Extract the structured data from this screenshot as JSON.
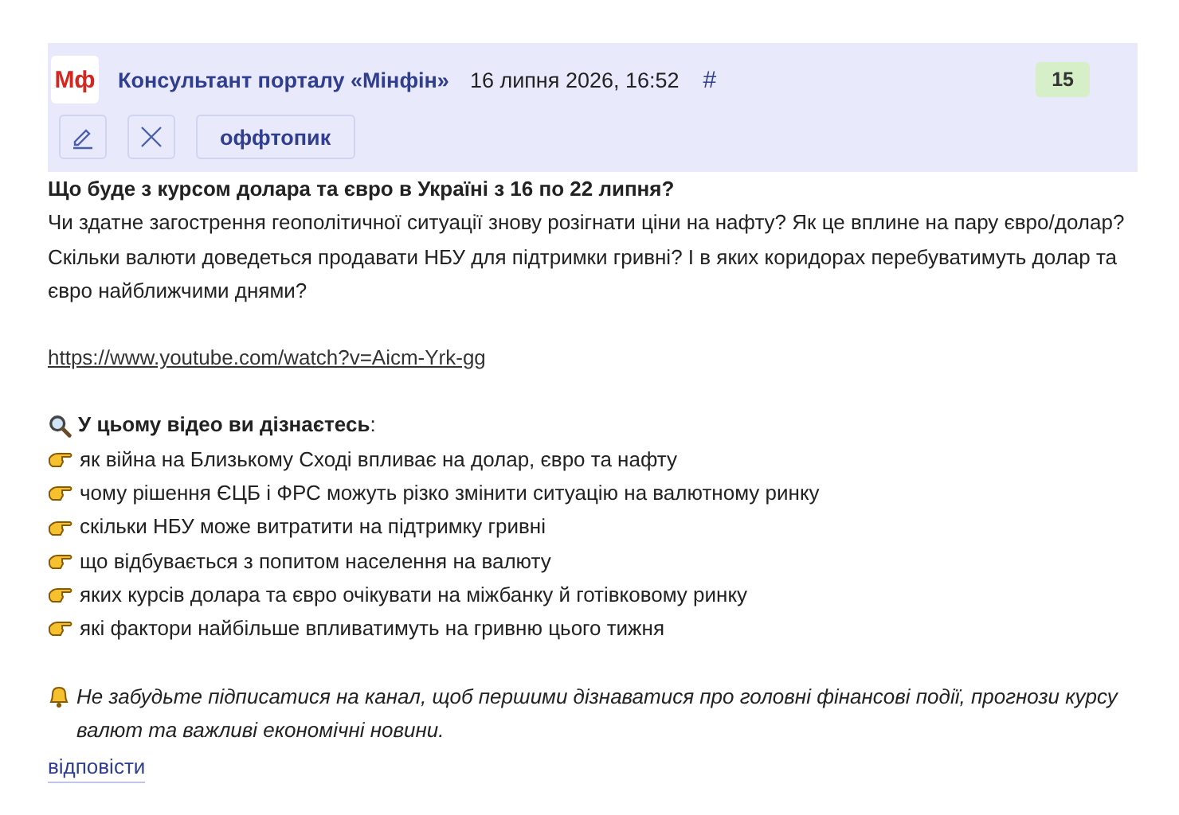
{
  "comment": {
    "logo": "Мф",
    "author": "Консультант порталу «Мінфін»",
    "date": "16 липня 2026, 16:52",
    "anchor": "#",
    "score": "15",
    "tag": "оффтопик",
    "title": "Що буде з курсом долара та євро в Україні з 16 по 22 липня?",
    "paragraph": "Чи здатне загострення геополітичної ситуації знову розігнати ціни на нафту? Як це вплине на пару євро/долар? Скільки валюти доведеться продавати НБУ для підтримки гривні? І в яких коридорах перебуватимуть долар та євро найближчими днями?",
    "link": "https://www.youtube.com/watch?v=Aicm-Yrk-gg",
    "list_heading": "**У цьому відео ви дізнаєтесь**:",
    "bullets": [
      "як війна на Близькому Сході впливає на долар, євро та нафту",
      "чому рішення ЄЦБ і ФРС можуть різко змінити ситуацію на валютному ринку",
      "скільки НБУ може витратити на підтримку гривні",
      "що відбувається з попитом населення на валюту",
      "яких курсів долара та євро очікувати на міжбанку й готівковому ринку",
      "які фактори найбільше впливатимуть на гривню цього тижня"
    ],
    "note": "Не забудьте підписатися на канал, щоб першими дізнаватися про головні фінансові події, прогнози курсу валют та важливі економічні новини.",
    "reply": "відповісти"
  }
}
